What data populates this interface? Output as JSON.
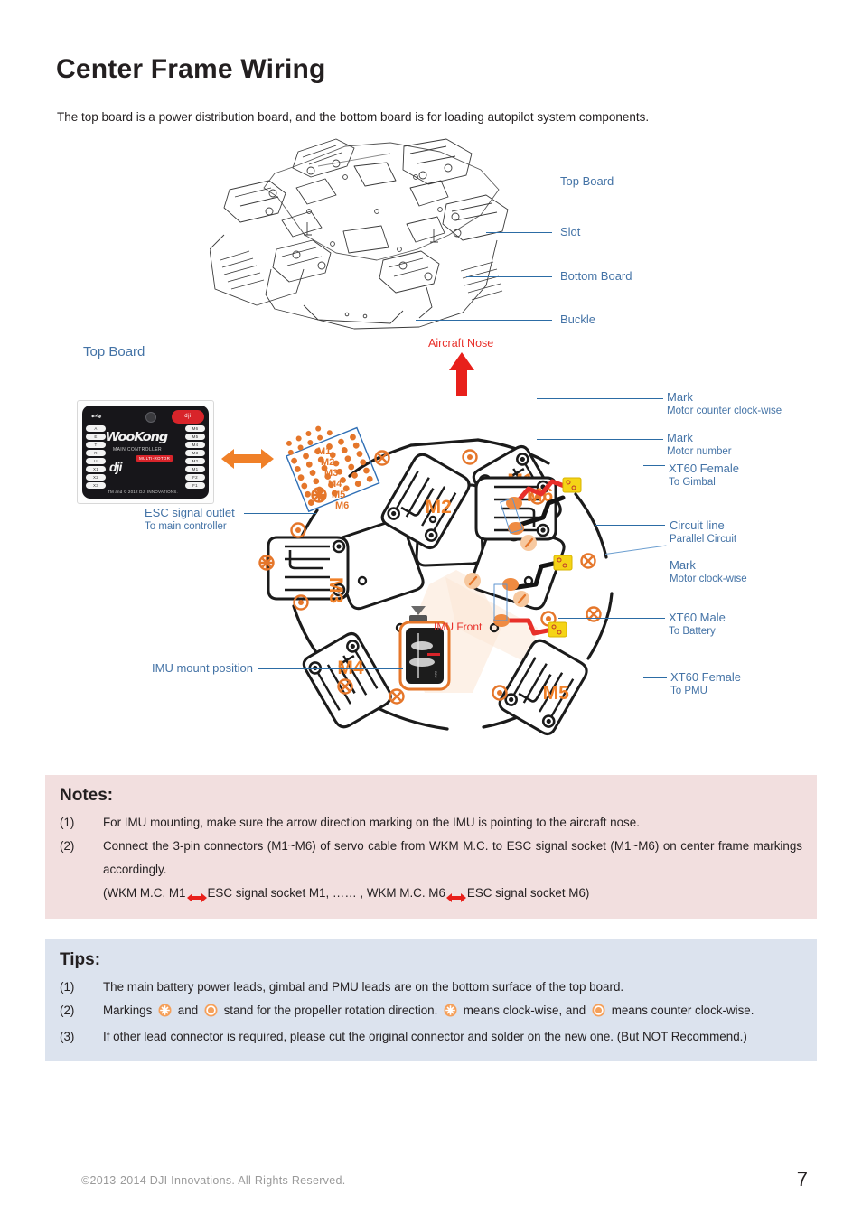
{
  "page": {
    "title": "Center Frame Wiring",
    "intro": "The top board is a power distribution board, and the bottom board is for loading autopilot system components.",
    "footer_copyright": "©2013-2014 DJI Innovations. All Rights Reserved.",
    "page_number": "7"
  },
  "colors": {
    "label_blue": "#4473a6",
    "leader_blue": "#2c6ca5",
    "accent_orange": "#f08028",
    "red": "#e8302a",
    "notes_bg": "#f2dfdf",
    "tips_bg": "#dce3ee"
  },
  "exploded_view": {
    "labels": [
      {
        "text": "Top Board"
      },
      {
        "text": "Slot"
      },
      {
        "text": "Bottom Board"
      },
      {
        "text": "Buckle"
      }
    ]
  },
  "top_board_section": {
    "heading": "Top Board",
    "aircraft_nose": "Aircraft Nose",
    "imu_front": "IMU Front",
    "motor_marks": [
      "M1",
      "M2",
      "M3",
      "M4",
      "M5",
      "M6"
    ],
    "esc_socket_marks": [
      "M1",
      "M2",
      "M3",
      "M4",
      "M5",
      "M6"
    ],
    "left_labels": [
      {
        "text": "ESC signal outlet",
        "sub": "To main controller"
      },
      {
        "text": "IMU mount position",
        "sub": ""
      }
    ],
    "right_labels": [
      {
        "text": "Mark",
        "sub": "Motor counter clock-wise"
      },
      {
        "text": "Mark",
        "sub": "Motor number"
      },
      {
        "text": "XT60 Female",
        "sub": "To Gimbal"
      },
      {
        "text": "Circuit line",
        "sub": "Parallel Circuit"
      },
      {
        "text": "Mark",
        "sub": "Motor clock-wise"
      },
      {
        "text": "XT60 Male",
        "sub": "To Battery"
      },
      {
        "text": "XT60 Female",
        "sub": "To PMU"
      }
    ]
  },
  "wkm_board": {
    "brand": "WooKong",
    "model": "MAIN CONTROLLER",
    "badge": "MULTI-ROTOR",
    "logo": "dji",
    "trademark": "TM and © 2012 DJI INNOVATIONS.",
    "led_label": "dji",
    "pins_left": [
      "A",
      "E",
      "T",
      "R",
      "U",
      "X1",
      "X2",
      "X3"
    ],
    "pins_right": [
      "M6",
      "M5",
      "M4",
      "M3",
      "M2",
      "M1",
      "F2",
      "F1"
    ]
  },
  "notes": {
    "heading": "Notes:",
    "items": [
      {
        "num": "(1)",
        "text": "For IMU mounting, make sure the arrow direction marking on the IMU is pointing to the aircraft nose."
      },
      {
        "num": "(2)",
        "text": "Connect the 3-pin connectors (M1~M6) of servo cable from WKM M.C. to ESC signal socket (M1~M6) on center frame markings accordingly."
      }
    ],
    "sub_line_part1": "(WKM M.C. M1",
    "sub_line_part2": "ESC signal socket M1, …… , WKM M.C. M6",
    "sub_line_part3": "ESC signal socket M6)"
  },
  "tips": {
    "heading": "Tips:",
    "items": [
      {
        "num": "(1)",
        "text": "The main battery power leads, gimbal and PMU leads are on the bottom surface of the top board."
      },
      {
        "num": "(3)",
        "text": "If other lead connector is required, please cut the original connector and solder on the new one. (But NOT Recommend.)"
      }
    ],
    "tip2": {
      "num": "(2)",
      "part1": "Markings",
      "part2": "and",
      "part3": "stand  for  the  propeller  rotation  direction.",
      "part4": "means  clock-wise,  and",
      "part5": "means  counter clock-wise."
    }
  }
}
